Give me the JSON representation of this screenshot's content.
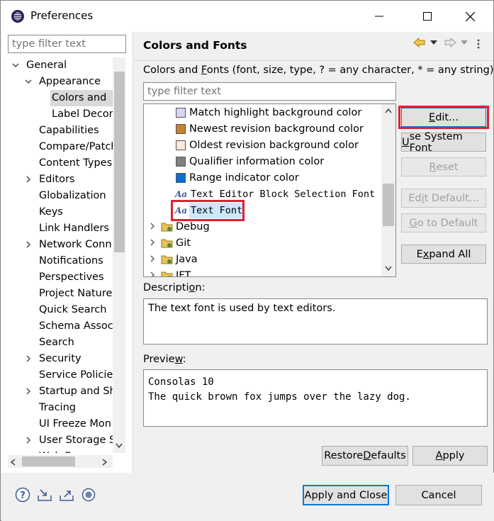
{
  "window": {
    "title": "Preferences"
  },
  "left": {
    "filter_placeholder": "type filter text",
    "tree": [
      {
        "label": "General",
        "level": 0,
        "twisty": "open"
      },
      {
        "label": "Appearance",
        "level": 1,
        "twisty": "open"
      },
      {
        "label": "Colors and",
        "level": 2,
        "twisty": "none",
        "selected": true
      },
      {
        "label": "Label Decor",
        "level": 2,
        "twisty": "none"
      },
      {
        "label": "Capabilities",
        "level": 1,
        "twisty": "none"
      },
      {
        "label": "Compare/Patch",
        "level": 1,
        "twisty": "none"
      },
      {
        "label": "Content Types",
        "level": 1,
        "twisty": "none"
      },
      {
        "label": "Editors",
        "level": 1,
        "twisty": "closed"
      },
      {
        "label": "Globalization",
        "level": 1,
        "twisty": "none"
      },
      {
        "label": "Keys",
        "level": 1,
        "twisty": "none"
      },
      {
        "label": "Link Handlers",
        "level": 1,
        "twisty": "none"
      },
      {
        "label": "Network Conn",
        "level": 1,
        "twisty": "closed"
      },
      {
        "label": "Notifications",
        "level": 1,
        "twisty": "none"
      },
      {
        "label": "Perspectives",
        "level": 1,
        "twisty": "none"
      },
      {
        "label": "Project Natures",
        "level": 1,
        "twisty": "none"
      },
      {
        "label": "Quick Search",
        "level": 1,
        "twisty": "none"
      },
      {
        "label": "Schema Associ",
        "level": 1,
        "twisty": "none"
      },
      {
        "label": "Search",
        "level": 1,
        "twisty": "none"
      },
      {
        "label": "Security",
        "level": 1,
        "twisty": "closed"
      },
      {
        "label": "Service Policies",
        "level": 1,
        "twisty": "none"
      },
      {
        "label": "Startup and Sh",
        "level": 1,
        "twisty": "closed"
      },
      {
        "label": "Tracing",
        "level": 1,
        "twisty": "none"
      },
      {
        "label": "UI Freeze Mon",
        "level": 1,
        "twisty": "none"
      },
      {
        "label": "User Storage S",
        "level": 1,
        "twisty": "closed"
      },
      {
        "label": "Web Browser",
        "level": 1,
        "twisty": "none"
      }
    ]
  },
  "right": {
    "title": "Colors and Fonts",
    "intro_pre": "Colors and ",
    "intro_u": "F",
    "intro_post": "onts (font, size, type, ? = any character, * = any string) :",
    "filter_placeholder": "type filter text",
    "list": [
      {
        "kind": "color",
        "label": "Match highlight background color",
        "color": "#d8d4f4"
      },
      {
        "kind": "color",
        "label": "Newest revision background color",
        "color": "#c8802c"
      },
      {
        "kind": "color",
        "label": "Oldest revision background color",
        "color": "#fbe8dc"
      },
      {
        "kind": "color",
        "label": "Qualifier information color",
        "color": "#808080"
      },
      {
        "kind": "color",
        "label": "Range indicator color",
        "color": "#0b6ed4"
      },
      {
        "kind": "font",
        "label": "Text Editor Block Selection Font"
      },
      {
        "kind": "font",
        "label": "Text Font",
        "selected": true
      },
      {
        "kind": "category",
        "label": "Debug"
      },
      {
        "kind": "category",
        "label": "Git"
      },
      {
        "kind": "category",
        "label": "Java"
      },
      {
        "kind": "category",
        "label": "JFT"
      }
    ],
    "font_icon_text": "Aa",
    "buttons": {
      "edit": {
        "pre": "",
        "u": "E",
        "post": "dit..."
      },
      "use_system_font": {
        "pre": "",
        "u": "U",
        "post": "se System Font"
      },
      "reset": {
        "pre": "",
        "u": "R",
        "post": "eset"
      },
      "edit_default": {
        "pre": "Ed",
        "u": "i",
        "post": "t Default..."
      },
      "go_to_default": {
        "pre": "",
        "u": "G",
        "post": "o to Default"
      },
      "expand_all": {
        "pre": "E",
        "u": "x",
        "post": "pand All"
      }
    },
    "description_label": {
      "pre": "Descripti",
      "u": "o",
      "post": "n:"
    },
    "description_text": "The text font is used by text editors.",
    "preview_label": {
      "pre": "Previe",
      "u": "w",
      "post": ":"
    },
    "preview_lines": [
      "Consolas 10",
      "The quick brown fox jumps over the lazy dog."
    ],
    "restore_defaults": {
      "pre": "Restore ",
      "u": "D",
      "post": "efaults"
    },
    "apply": {
      "pre": "",
      "u": "A",
      "post": "pply"
    }
  },
  "footer": {
    "apply_and_close": "Apply and Close",
    "cancel": "Cancel"
  },
  "colors": {
    "highlight_red": "#e3202e",
    "selection_blue": "#cce8ff",
    "default_button_border": "#0078d7"
  }
}
